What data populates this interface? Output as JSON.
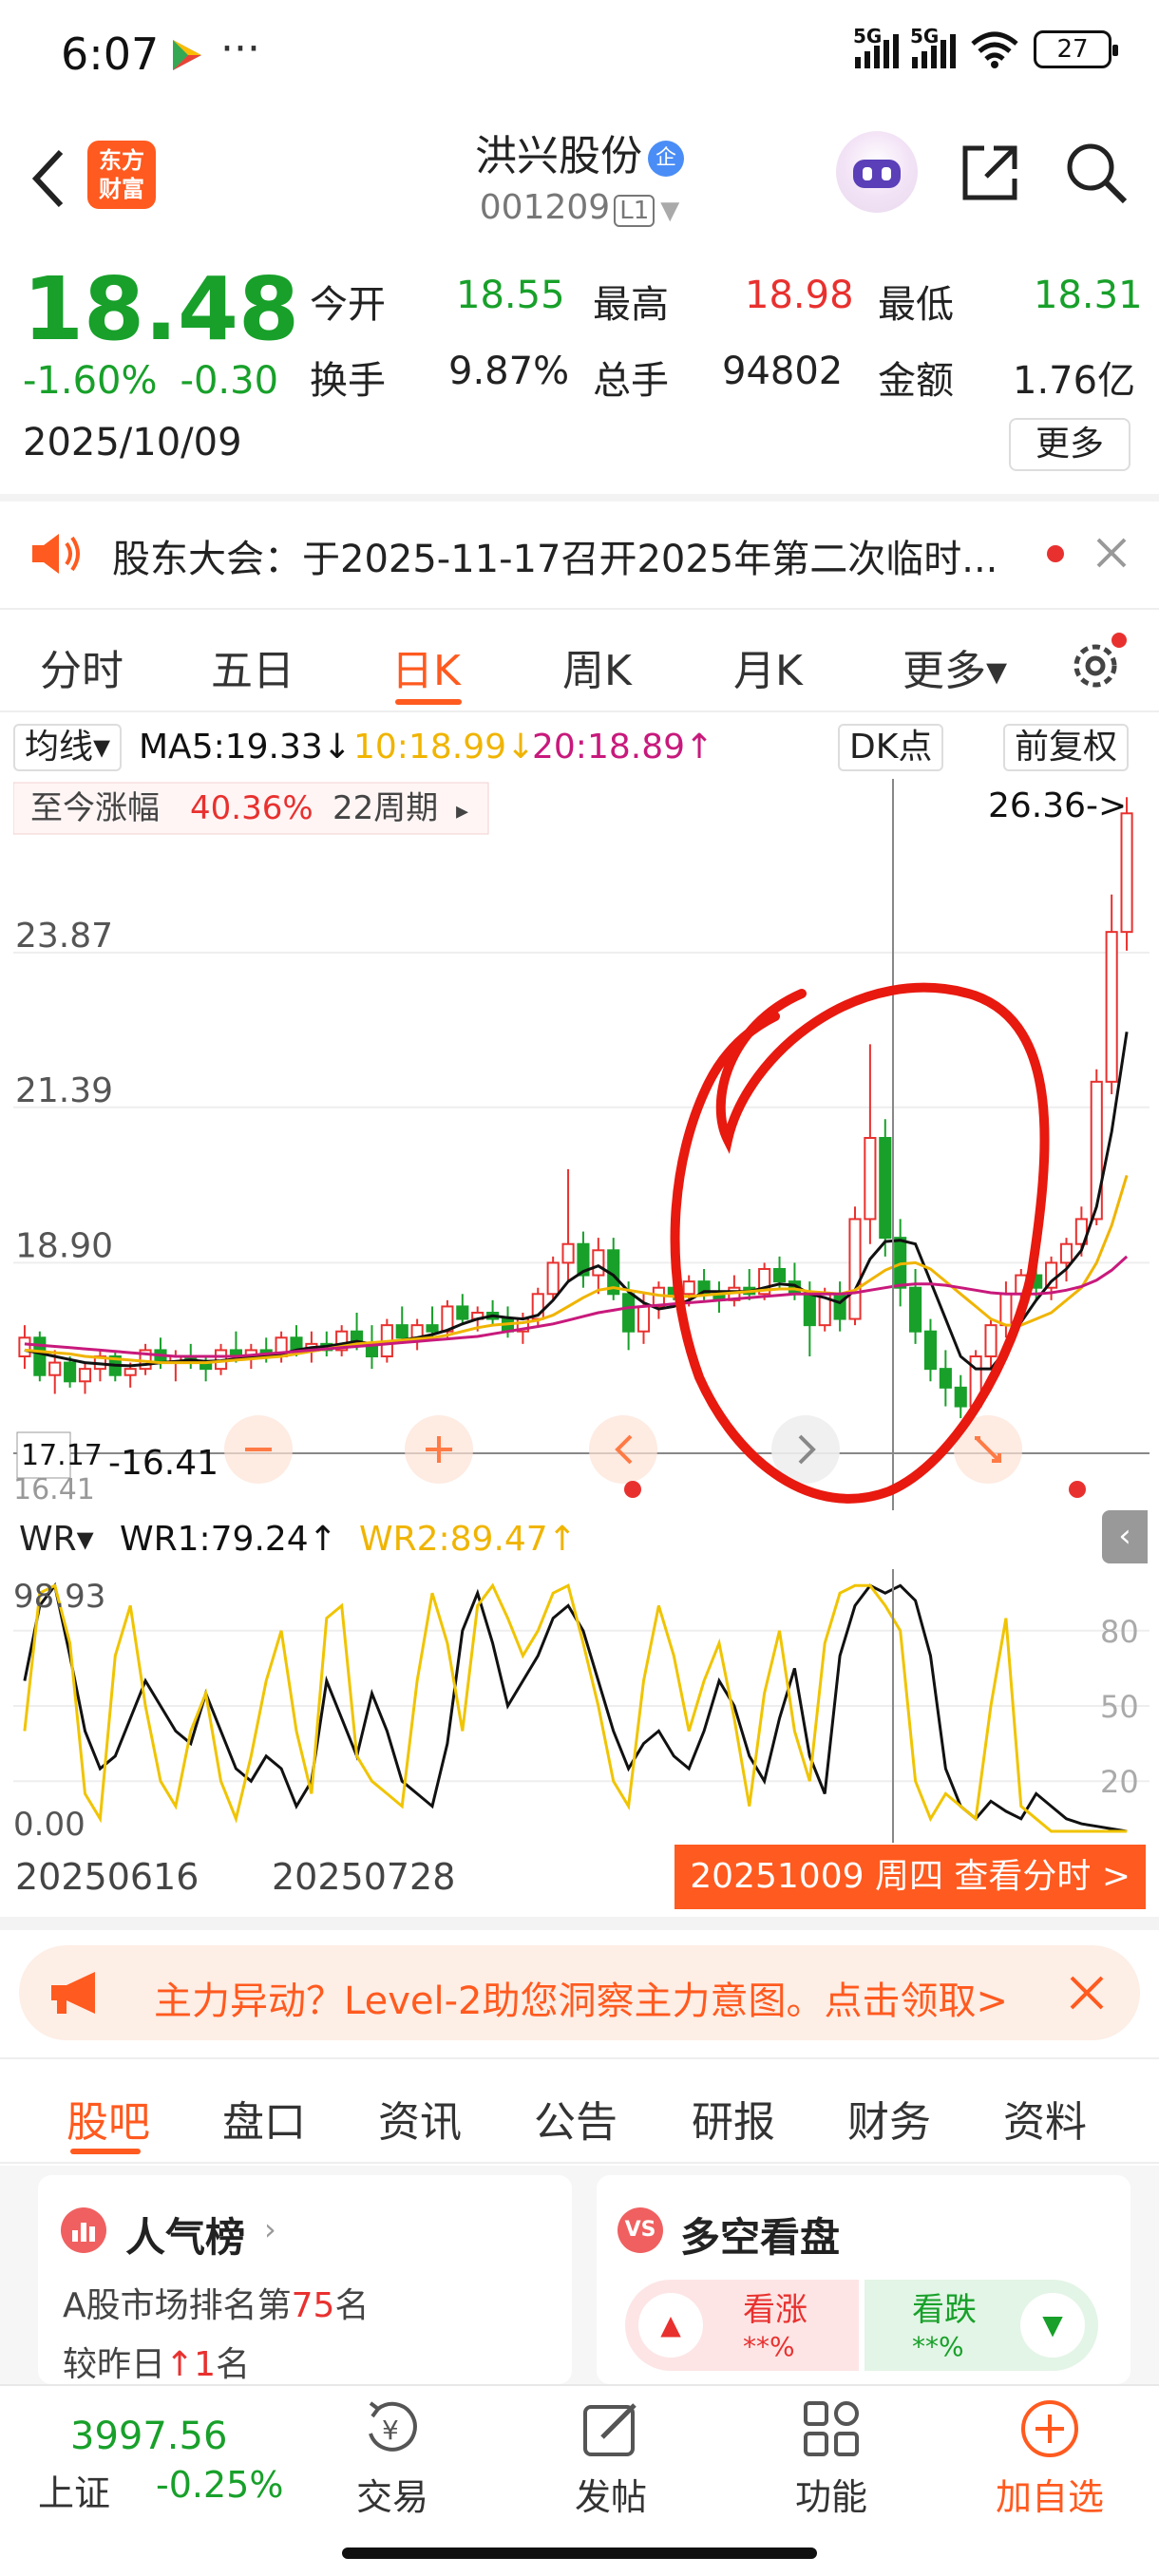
{
  "status_bar": {
    "time": "6:07",
    "dots": "···",
    "net1": "5G",
    "net2": "5G",
    "battery": "27"
  },
  "header": {
    "logo_line1": "东方",
    "logo_line2": "财富",
    "stock_name": "洪兴股份",
    "badge": "企",
    "stock_code": "001209",
    "level": "L1"
  },
  "quote": {
    "price": "18.48",
    "change_pct": "-1.60%",
    "change": "-0.30",
    "date": "2025/10/09",
    "open_label": "今开",
    "open": "18.55",
    "high_label": "最高",
    "high": "18.98",
    "low_label": "最低",
    "low": "18.31",
    "turnover_label": "换手",
    "turnover": "9.87%",
    "volume_label": "总手",
    "volume": "94802",
    "amount_label": "金额",
    "amount": "1.76亿",
    "more": "更多"
  },
  "notice": {
    "text": "股东大会：于2025-11-17召开2025年第二次临时..."
  },
  "kline_tabs": [
    {
      "label": "分时"
    },
    {
      "label": "五日"
    },
    {
      "label": "日K"
    },
    {
      "label": "周K"
    },
    {
      "label": "月K"
    },
    {
      "label": "更多▾"
    }
  ],
  "ma_row": {
    "indicator": "均线▾",
    "ma5": "MA5:19.33↓",
    "ma10": "10:18.99↓",
    "ma20": "20:18.89↑",
    "dk": "DK点",
    "fq": "前复权"
  },
  "chart_overlay": {
    "range_label": "至今涨幅",
    "range_pct": "40.36%",
    "range_period": "22周期",
    "max_label": "26.36->",
    "min_label": "-16.41",
    "cross_price": "17.17",
    "cross_price2": "16.41"
  },
  "wr_row": {
    "indicator": "WR▾",
    "wr1": "WR1:79.24↑",
    "wr2": "WR2:89.47↑"
  },
  "dates": {
    "start": "20250616",
    "mid": "20250728",
    "selected": "20251009 周四 查看分时 >"
  },
  "promo": {
    "text": "主力异动？Level-2助您洞察主力意图。点击领取>"
  },
  "bottom_tabs": [
    {
      "label": "股吧"
    },
    {
      "label": "盘口"
    },
    {
      "label": "资讯"
    },
    {
      "label": "公告"
    },
    {
      "label": "研报"
    },
    {
      "label": "财务"
    },
    {
      "label": "资料"
    }
  ],
  "cards": {
    "popular_title": "人气榜",
    "popular_line1_a": "A股市场排名第",
    "popular_rank": "75",
    "popular_line1_b": "名",
    "popular_line2_a": "较昨日",
    "popular_change": "↑1",
    "popular_line2_b": "名",
    "vs_title": "多空看盘",
    "bull_label": "看涨",
    "bull_pct": "**%",
    "bear_label": "看跌",
    "bear_pct": "**%"
  },
  "nav": {
    "index_value": "3997.56",
    "index_name": "上证",
    "index_change": "-0.25%",
    "items": [
      {
        "label": "交易"
      },
      {
        "label": "发帖"
      },
      {
        "label": "功能"
      },
      {
        "label": "加自选"
      }
    ]
  },
  "colors": {
    "up": "#e8312f",
    "down": "#18a02a",
    "accent": "#ff5a1f",
    "ma5": "#111111",
    "ma10": "#f0b400",
    "ma20": "#c8197c"
  },
  "chart_data": [
    {
      "type": "candlestick",
      "title": "",
      "y_ticks": [
        23.87,
        21.39,
        18.9
      ],
      "ylim": [
        16.0,
        26.5
      ],
      "x_labels": [
        "20250616",
        "20250728"
      ],
      "highest": 26.36,
      "lowest": 16.41,
      "candles": [
        [
          17.4,
          17.9,
          17.2,
          17.7
        ],
        [
          17.7,
          17.8,
          17.0,
          17.1
        ],
        [
          17.1,
          17.5,
          16.8,
          17.3
        ],
        [
          17.3,
          17.4,
          16.9,
          17.0
        ],
        [
          17.0,
          17.3,
          16.8,
          17.2
        ],
        [
          17.2,
          17.5,
          17.0,
          17.4
        ],
        [
          17.4,
          17.5,
          17.0,
          17.1
        ],
        [
          17.1,
          17.3,
          16.9,
          17.2
        ],
        [
          17.2,
          17.6,
          17.1,
          17.5
        ],
        [
          17.5,
          17.7,
          17.2,
          17.3
        ],
        [
          17.3,
          17.5,
          17.0,
          17.4
        ],
        [
          17.4,
          17.6,
          17.2,
          17.3
        ],
        [
          17.3,
          17.4,
          17.0,
          17.2
        ],
        [
          17.2,
          17.6,
          17.1,
          17.5
        ],
        [
          17.5,
          17.8,
          17.3,
          17.4
        ],
        [
          17.4,
          17.6,
          17.2,
          17.5
        ],
        [
          17.5,
          17.7,
          17.3,
          17.4
        ],
        [
          17.4,
          17.8,
          17.3,
          17.7
        ],
        [
          17.7,
          17.9,
          17.4,
          17.5
        ],
        [
          17.5,
          17.8,
          17.3,
          17.6
        ],
        [
          17.6,
          17.8,
          17.4,
          17.5
        ],
        [
          17.5,
          17.9,
          17.4,
          17.8
        ],
        [
          17.8,
          18.1,
          17.5,
          17.6
        ],
        [
          17.6,
          17.9,
          17.2,
          17.4
        ],
        [
          17.4,
          18.0,
          17.3,
          17.9
        ],
        [
          17.9,
          18.2,
          17.6,
          17.7
        ],
        [
          17.7,
          18.0,
          17.5,
          17.9
        ],
        [
          17.9,
          18.2,
          17.7,
          17.8
        ],
        [
          17.8,
          18.3,
          17.7,
          18.2
        ],
        [
          18.2,
          18.4,
          17.9,
          18.0
        ],
        [
          18.0,
          18.2,
          17.8,
          18.1
        ],
        [
          18.1,
          18.3,
          17.9,
          18.0
        ],
        [
          18.0,
          18.2,
          17.7,
          17.8
        ],
        [
          17.8,
          18.1,
          17.6,
          18.0
        ],
        [
          18.0,
          18.5,
          17.9,
          18.4
        ],
        [
          18.4,
          19.0,
          18.3,
          18.9
        ],
        [
          18.9,
          20.4,
          18.6,
          19.2
        ],
        [
          19.2,
          19.4,
          18.5,
          18.7
        ],
        [
          18.7,
          19.3,
          18.4,
          19.1
        ],
        [
          19.1,
          19.3,
          18.3,
          18.4
        ],
        [
          18.4,
          18.6,
          17.5,
          17.8
        ],
        [
          17.8,
          18.4,
          17.6,
          18.2
        ],
        [
          18.2,
          18.6,
          18.0,
          18.5
        ],
        [
          18.5,
          18.9,
          18.3,
          18.4
        ],
        [
          18.4,
          18.7,
          18.2,
          18.6
        ],
        [
          18.6,
          18.8,
          18.3,
          18.4
        ],
        [
          18.4,
          18.6,
          18.1,
          18.3
        ],
        [
          18.3,
          18.7,
          18.2,
          18.5
        ],
        [
          18.5,
          18.8,
          18.3,
          18.4
        ],
        [
          18.4,
          18.9,
          18.3,
          18.8
        ],
        [
          18.8,
          19.0,
          18.5,
          18.6
        ],
        [
          18.6,
          18.9,
          18.3,
          18.4
        ],
        [
          18.4,
          18.6,
          17.4,
          17.9
        ],
        [
          17.9,
          18.5,
          17.8,
          18.4
        ],
        [
          18.4,
          18.6,
          17.8,
          18.0
        ],
        [
          18.0,
          19.8,
          17.9,
          19.6
        ],
        [
          19.6,
          22.4,
          19.2,
          20.9
        ],
        [
          20.9,
          21.2,
          19.0,
          19.3
        ],
        [
          19.3,
          19.6,
          18.2,
          18.5
        ],
        [
          18.5,
          18.8,
          17.6,
          17.8
        ],
        [
          17.8,
          18.0,
          17.0,
          17.2
        ],
        [
          17.2,
          17.5,
          16.6,
          16.9
        ],
        [
          16.9,
          17.1,
          16.41,
          16.6
        ],
        [
          16.6,
          17.5,
          16.5,
          17.4
        ],
        [
          17.4,
          18.0,
          17.2,
          17.9
        ],
        [
          17.9,
          18.6,
          17.7,
          18.4
        ],
        [
          18.4,
          18.8,
          18.0,
          18.7
        ],
        [
          18.7,
          18.9,
          18.3,
          18.5
        ],
        [
          18.5,
          19.0,
          18.3,
          18.9
        ],
        [
          18.9,
          19.3,
          18.6,
          19.2
        ],
        [
          19.2,
          19.8,
          19.0,
          19.6
        ],
        [
          19.6,
          22.0,
          19.5,
          21.8
        ],
        [
          21.8,
          24.8,
          21.6,
          24.2
        ],
        [
          24.2,
          26.36,
          23.9,
          26.1
        ]
      ],
      "series": [
        {
          "name": "MA5",
          "values": [
            17.5,
            17.45,
            17.4,
            17.35,
            17.3,
            17.28,
            17.26,
            17.25,
            17.27,
            17.3,
            17.32,
            17.34,
            17.32,
            17.33,
            17.36,
            17.4,
            17.42,
            17.44,
            17.5,
            17.54,
            17.56,
            17.6,
            17.64,
            17.6,
            17.62,
            17.66,
            17.7,
            17.75,
            17.82,
            17.92,
            18.0,
            18.05,
            18.02,
            18.0,
            18.06,
            18.3,
            18.6,
            18.76,
            18.85,
            18.7,
            18.44,
            18.26,
            18.16,
            18.2,
            18.3,
            18.44,
            18.44,
            18.44,
            18.44,
            18.5,
            18.56,
            18.54,
            18.4,
            18.34,
            18.26,
            18.46,
            18.96,
            19.24,
            19.26,
            19.2,
            18.6,
            18.0,
            17.4,
            17.2,
            17.2,
            17.5,
            17.95,
            18.3,
            18.6,
            18.8,
            19.1,
            19.8,
            21.0,
            22.6
          ]
        },
        {
          "name": "MA10",
          "values": [
            17.5,
            17.48,
            17.46,
            17.44,
            17.4,
            17.38,
            17.36,
            17.34,
            17.32,
            17.3,
            17.3,
            17.3,
            17.3,
            17.32,
            17.34,
            17.36,
            17.38,
            17.4,
            17.44,
            17.48,
            17.52,
            17.56,
            17.6,
            17.62,
            17.64,
            17.66,
            17.68,
            17.7,
            17.74,
            17.8,
            17.86,
            17.9,
            17.92,
            17.94,
            17.98,
            18.06,
            18.2,
            18.34,
            18.46,
            18.5,
            18.46,
            18.42,
            18.38,
            18.36,
            18.36,
            18.38,
            18.4,
            18.42,
            18.44,
            18.46,
            18.48,
            18.48,
            18.44,
            18.42,
            18.4,
            18.46,
            18.62,
            18.78,
            18.88,
            18.9,
            18.8,
            18.6,
            18.4,
            18.2,
            18.0,
            17.9,
            17.9,
            18.0,
            18.1,
            18.3,
            18.5,
            18.9,
            19.5,
            20.3
          ]
        },
        {
          "name": "MA20",
          "values": [
            17.6,
            17.58,
            17.56,
            17.54,
            17.52,
            17.5,
            17.48,
            17.46,
            17.44,
            17.42,
            17.4,
            17.4,
            17.4,
            17.4,
            17.4,
            17.42,
            17.44,
            17.46,
            17.48,
            17.5,
            17.52,
            17.54,
            17.56,
            17.58,
            17.6,
            17.62,
            17.64,
            17.66,
            17.68,
            17.7,
            17.72,
            17.76,
            17.8,
            17.84,
            17.88,
            17.92,
            17.98,
            18.04,
            18.1,
            18.14,
            18.18,
            18.2,
            18.22,
            18.24,
            18.26,
            18.28,
            18.3,
            18.32,
            18.34,
            18.36,
            18.38,
            18.4,
            18.4,
            18.4,
            18.4,
            18.42,
            18.46,
            18.5,
            18.54,
            18.56,
            18.56,
            18.54,
            18.5,
            18.46,
            18.42,
            18.4,
            18.4,
            18.4,
            18.42,
            18.46,
            18.52,
            18.62,
            18.78,
            19.0
          ]
        }
      ]
    },
    {
      "type": "line",
      "title": "WR",
      "ylim": [
        0,
        100
      ],
      "y_ticks": [
        80,
        50,
        20
      ],
      "y_labels": [
        "98.93",
        "0.00"
      ],
      "series": [
        {
          "name": "WR1",
          "values": [
            60,
            90,
            98,
            70,
            40,
            25,
            30,
            45,
            60,
            50,
            40,
            35,
            55,
            40,
            25,
            20,
            30,
            25,
            10,
            20,
            60,
            45,
            30,
            55,
            40,
            20,
            15,
            10,
            35,
            80,
            95,
            75,
            50,
            60,
            70,
            85,
            90,
            80,
            60,
            40,
            25,
            35,
            40,
            30,
            25,
            40,
            60,
            50,
            30,
            20,
            45,
            65,
            30,
            15,
            70,
            90,
            98,
            95,
            98,
            92,
            70,
            25,
            10,
            5,
            12,
            8,
            5,
            15,
            10,
            5,
            3,
            2,
            1,
            0
          ]
        },
        {
          "name": "WR2",
          "values": [
            40,
            95,
            98,
            75,
            15,
            5,
            70,
            90,
            50,
            20,
            10,
            40,
            55,
            20,
            5,
            30,
            60,
            80,
            40,
            15,
            85,
            90,
            30,
            20,
            15,
            10,
            60,
            95,
            75,
            40,
            90,
            98,
            85,
            70,
            80,
            95,
            98,
            75,
            50,
            20,
            10,
            60,
            90,
            70,
            40,
            60,
            75,
            45,
            10,
            55,
            80,
            40,
            20,
            75,
            95,
            98,
            98,
            90,
            80,
            20,
            5,
            15,
            10,
            5,
            50,
            85,
            10,
            5,
            0,
            0,
            0,
            0,
            0,
            0
          ]
        }
      ]
    }
  ]
}
